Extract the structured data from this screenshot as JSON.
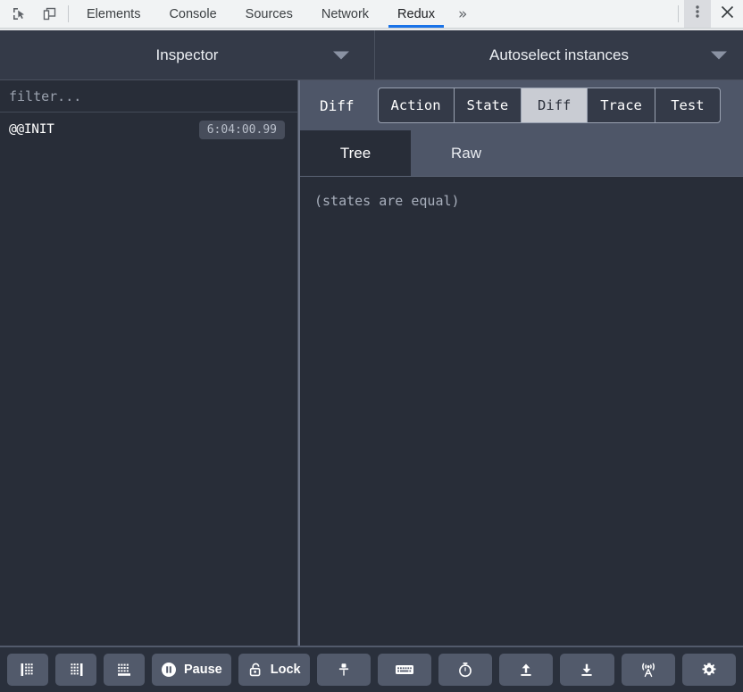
{
  "devtools": {
    "icons": {
      "inspect": "inspect-element-icon",
      "device": "device-toolbar-icon",
      "kebab": "more-options-icon",
      "close": "close-icon"
    },
    "tabs": [
      {
        "label": "Elements",
        "active": false
      },
      {
        "label": "Console",
        "active": false
      },
      {
        "label": "Sources",
        "active": false
      },
      {
        "label": "Network",
        "active": false
      },
      {
        "label": "Redux",
        "active": true
      }
    ],
    "more_tabs_label": "»",
    "accent_color": "#1a73e8",
    "bar_background": "#f1f3f4"
  },
  "redux": {
    "header": {
      "monitor_select": "Inspector",
      "instance_select": "Autoselect instances"
    },
    "left": {
      "filter_placeholder": "filter...",
      "filter_value": "",
      "actions": [
        {
          "name": "@@INIT",
          "time": "6:04:00.99"
        }
      ]
    },
    "right": {
      "tabbar_title": "Diff",
      "tabs": [
        {
          "label": "Action",
          "selected": false
        },
        {
          "label": "State",
          "selected": false
        },
        {
          "label": "Diff",
          "selected": true
        },
        {
          "label": "Trace",
          "selected": false
        },
        {
          "label": "Test",
          "selected": false
        }
      ],
      "subtabs": [
        {
          "label": "Tree",
          "active": true
        },
        {
          "label": "Raw",
          "active": false
        }
      ],
      "content_message": "(states are equal)"
    },
    "bottom": {
      "buttons": [
        {
          "name": "dock-left-button",
          "icon": "dock-left-icon",
          "label": ""
        },
        {
          "name": "dock-right-button",
          "icon": "dock-right-icon",
          "label": ""
        },
        {
          "name": "dock-bottom-button",
          "icon": "dock-bottom-icon",
          "label": ""
        },
        {
          "name": "pause-button",
          "icon": "pause-icon",
          "label": "Pause"
        },
        {
          "name": "lock-button",
          "icon": "lock-icon",
          "label": "Lock"
        },
        {
          "name": "pin-button",
          "icon": "pin-icon",
          "label": ""
        },
        {
          "name": "keyboard-button",
          "icon": "keyboard-icon",
          "label": ""
        },
        {
          "name": "slow-motion-button",
          "icon": "stopwatch-icon",
          "label": ""
        },
        {
          "name": "import-button",
          "icon": "upload-icon",
          "label": ""
        },
        {
          "name": "export-button",
          "icon": "download-icon",
          "label": ""
        },
        {
          "name": "remote-button",
          "icon": "broadcast-icon",
          "label": ""
        },
        {
          "name": "settings-button",
          "icon": "gear-icon",
          "label": ""
        }
      ]
    },
    "theme": {
      "panel_background": "#282d38",
      "header_background": "#343a48",
      "tabbar_background": "#4e5668",
      "button_background": "#525a6b",
      "selected_tab_background": "#c9ccd3"
    }
  }
}
